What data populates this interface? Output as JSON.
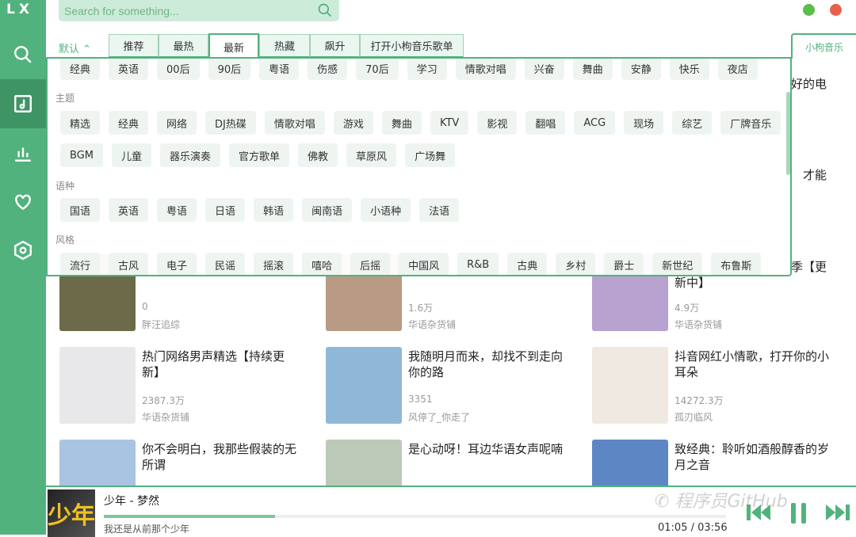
{
  "app": {
    "logo": "LX"
  },
  "sidebar": {
    "items": [
      {
        "icon": "search-icon"
      },
      {
        "icon": "music-library-icon",
        "active": true
      },
      {
        "icon": "chart-icon"
      },
      {
        "icon": "heart-icon"
      },
      {
        "icon": "settings-icon"
      }
    ]
  },
  "search": {
    "placeholder": "Search for something..."
  },
  "window": {
    "minimize_color": "#5cbd4a",
    "close_color": "#e8604c"
  },
  "tabs": {
    "sort": "默认",
    "items": [
      "推荐",
      "最热",
      "最新",
      "热藏",
      "飙升",
      "打开小枸音乐歌单"
    ],
    "active": "最新",
    "source": "小枸音乐"
  },
  "tag_popup": {
    "top_row": [
      "经典",
      "英语",
      "00后",
      "90后",
      "粤语",
      "伤感",
      "70后",
      "学习",
      "情歌对唱",
      "兴奋",
      "舞曲",
      "安静",
      "快乐",
      "夜店"
    ],
    "groups": [
      {
        "name": "主题",
        "rows": [
          [
            "精选",
            "经典",
            "网络",
            "DJ热碟",
            "情歌对唱",
            "游戏",
            "舞曲",
            "KTV",
            "影视",
            "翻唱",
            "ACG",
            "现场",
            "综艺",
            "厂牌音乐"
          ],
          [
            "BGM",
            "儿童",
            "器乐演奏",
            "官方歌单",
            "佛教",
            "草原风",
            "广场舞"
          ]
        ]
      },
      {
        "name": "语种",
        "rows": [
          [
            "国语",
            "英语",
            "粤语",
            "日语",
            "韩语",
            "闽南语",
            "小语种",
            "法语"
          ]
        ]
      },
      {
        "name": "风格",
        "rows": [
          [
            "流行",
            "古风",
            "电子",
            "民谣",
            "摇滚",
            "嘻哈",
            "后摇",
            "中国风",
            "R&B",
            "古典",
            "乡村",
            "爵士",
            "新世纪",
            "布鲁斯"
          ]
        ]
      }
    ]
  },
  "background_fragments": [
    "好的电",
    "才能",
    "季【更",
    "新中】"
  ],
  "playlists": [
    {
      "title": "",
      "count": "0",
      "author": "胖汪追综",
      "color": "#6d6a4a"
    },
    {
      "title": "",
      "count": "1.6万",
      "author": "华语杂货铺",
      "color": "#b99a84"
    },
    {
      "title": "",
      "count": "4.9万",
      "author": "华语杂货铺",
      "color": "#b7a2d0"
    },
    {
      "title": "热门网络男声精选【持续更新】",
      "count": "2387.3万",
      "author": "华语杂货铺",
      "color": "#e8e8ea"
    },
    {
      "title": "我随明月而来，却找不到走向你的路",
      "count": "3351",
      "author": "风停了_你走了",
      "color": "#8fb8d8"
    },
    {
      "title": "抖音网红小情歌，打开你的小耳朵",
      "count": "14272.3万",
      "author": "孤刃临风",
      "color": "#efe9e2"
    },
    {
      "title": "你不会明白，我那些假装的无所谓",
      "count": "",
      "author": "",
      "color": "#a9c4e2"
    },
    {
      "title": "是心动呀！耳边华语女声呢喃",
      "count": "",
      "author": "",
      "color": "#bcc9b8"
    },
    {
      "title": "致经典：聆听如酒般醇香的岁月之音",
      "count": "",
      "author": "",
      "color": "#5d86c4"
    }
  ],
  "player": {
    "cover_text": "少年",
    "title": "少年 - 梦然",
    "lyric": "我还是从前那个少年",
    "current": "01:05",
    "duration": "03:56",
    "progress": 0.275,
    "watermark": "程序员GitHub"
  }
}
